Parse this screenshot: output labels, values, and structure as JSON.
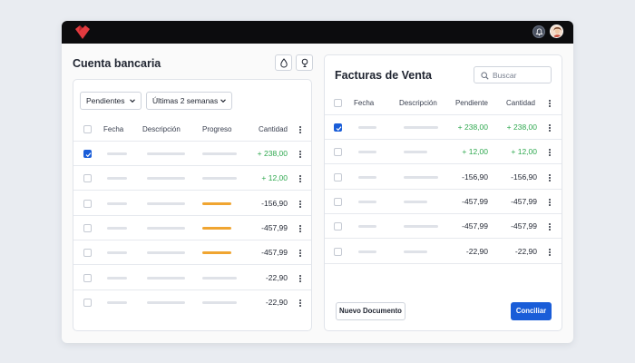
{
  "bank": {
    "title": "Cuenta bancaria",
    "filters": {
      "status": "Pendientes",
      "period": "Últimas 2 semanas"
    },
    "columns": {
      "date": "Fecha",
      "description": "Descripción",
      "progress": "Progreso",
      "amount": "Cantidad"
    },
    "rows": [
      {
        "checked": true,
        "amount": "+ 238,00",
        "positive": true,
        "progress": null
      },
      {
        "checked": false,
        "amount": "+ 12,00",
        "positive": true,
        "progress": null
      },
      {
        "checked": false,
        "amount": "-156,90",
        "positive": false,
        "progress": 1
      },
      {
        "checked": false,
        "amount": "-457,99",
        "positive": false,
        "progress": 1
      },
      {
        "checked": false,
        "amount": "-457,99",
        "positive": false,
        "progress": 1
      },
      {
        "checked": false,
        "amount": "-22,90",
        "positive": false,
        "progress": null
      },
      {
        "checked": false,
        "amount": "-22,90",
        "positive": false,
        "progress": null
      }
    ]
  },
  "invoices": {
    "title": "Facturas de Venta",
    "search": {
      "placeholder": "Buscar"
    },
    "columns": {
      "date": "Fecha",
      "description": "Descripción",
      "pending": "Pendiente",
      "amount": "Cantidad"
    },
    "rows": [
      {
        "checked": true,
        "pending": "+ 238,00",
        "amount": "+ 238,00",
        "positive": true
      },
      {
        "checked": false,
        "pending": "+ 12,00",
        "amount": "+ 12,00",
        "positive": true
      },
      {
        "checked": false,
        "pending": "-156,90",
        "amount": "-156,90",
        "positive": false
      },
      {
        "checked": false,
        "pending": "-457,99",
        "amount": "-457,99",
        "positive": false
      },
      {
        "checked": false,
        "pending": "-457,99",
        "amount": "-457,99",
        "positive": false
      },
      {
        "checked": false,
        "pending": "-22,90",
        "amount": "-22,90",
        "positive": false
      }
    ],
    "new_document_label": "Nuevo Documento",
    "reconcile_label": "Conciliar"
  },
  "colors": {
    "accent": "#1a5dd8",
    "positive": "#2fa84f",
    "progress": "#f0a531",
    "brand": "#e23a3f"
  },
  "icons": {
    "logo": "brand-logo-icon",
    "notifications": "bell-icon",
    "user": "avatar",
    "drop": "drop-icon",
    "lightbulb": "lightbulb-icon",
    "search": "search-icon"
  }
}
